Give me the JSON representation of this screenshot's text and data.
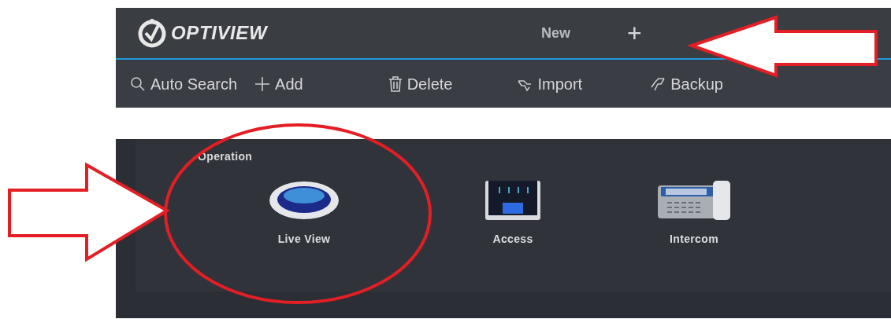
{
  "header": {
    "logo_text": "OPTIVIEW",
    "tab": "New",
    "add_tab": "+"
  },
  "toolbar": [
    {
      "kind": "search",
      "label": "Auto Search"
    },
    {
      "kind": "add",
      "label": "Add"
    },
    {
      "kind": "delete",
      "label": "Delete"
    },
    {
      "kind": "import",
      "label": "Import"
    },
    {
      "kind": "backup",
      "label": "Backup"
    }
  ],
  "section": {
    "title": "Operation",
    "items": [
      {
        "kind": "live",
        "label": "Live View"
      },
      {
        "kind": "access",
        "label": "Access"
      },
      {
        "kind": "intercom",
        "label": "Intercom"
      }
    ]
  }
}
